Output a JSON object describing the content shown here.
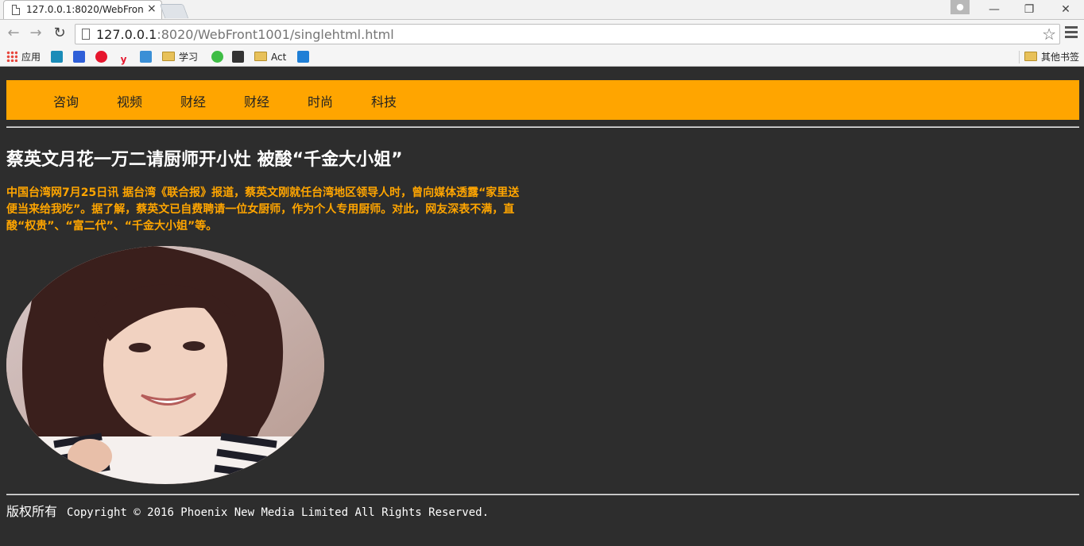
{
  "browser": {
    "tab_title": "127.0.0.1:8020/WebFron",
    "tab_close": "×",
    "window_minimize": "—",
    "window_restore": "❐",
    "window_close": "✕",
    "url_host": "127.0.0.1",
    "url_rest": ":8020/WebFront1001/singlehtml.html",
    "bookmarks": [
      {
        "label": "应用",
        "icon": "apps-icon"
      },
      {
        "label": "",
        "icon": "bing-icon",
        "color": "#1a8cb8"
      },
      {
        "label": "",
        "icon": "baidu-icon",
        "color": "#2f5fd8"
      },
      {
        "label": "",
        "icon": "weibo-icon",
        "color": "#e6162d"
      },
      {
        "label": "",
        "icon": "youdao-icon",
        "color": "#e6162d"
      },
      {
        "label": "",
        "icon": "photo-icon",
        "color": "#3a8fd6"
      },
      {
        "label": "学习",
        "icon": "folder-icon"
      },
      {
        "label": "",
        "icon": "iqiyi-icon",
        "color": "#3ebd45"
      },
      {
        "label": "",
        "icon": "tv-icon",
        "color": "#333333"
      },
      {
        "label": "Act",
        "icon": "folder-icon"
      },
      {
        "label": "",
        "icon": "app-icon",
        "color": "#1f7fd6"
      }
    ],
    "other_bookmarks": "其他书签"
  },
  "nav": {
    "items": [
      "咨询",
      "视频",
      "财经",
      "财经",
      "时尚",
      "科技"
    ],
    "bg_color": "#ffa500"
  },
  "article": {
    "headline": "蔡英文月花一万二请厨师开小灶 被酸“千金大小姐”",
    "body": "中国台湾网7月25日讯 据台湾《联合报》报道，蔡英文刚就任台湾地区领导人时，曾向媒体透露“家里送便当来给我吃”。据了解，蔡英文已自费聘请一位女厨师，作为个人专用厨师。对此，网友深表不满，直酸“权贵”、“富二代”、“千金大小姐”等。",
    "text_color": "#ffa500"
  },
  "footer": {
    "label": "版权所有",
    "copyright": "Copyright © 2016 Phoenix New Media Limited All Rights Reserved."
  },
  "colors": {
    "page_bg": "#2d2d2d",
    "accent": "#ffa500"
  }
}
